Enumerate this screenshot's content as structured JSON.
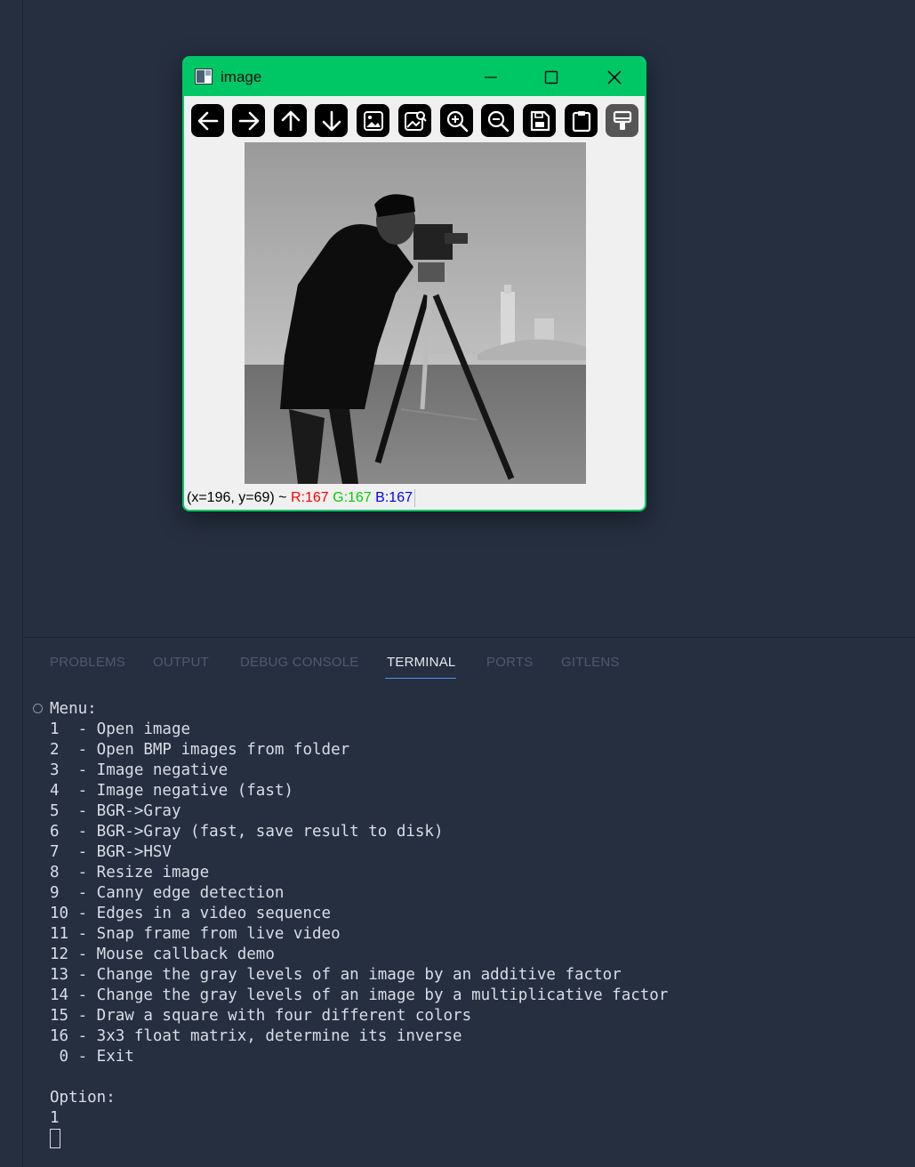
{
  "window": {
    "title": "image",
    "minimize_glyph": "—",
    "toolbar": [
      {
        "name": "pan-left",
        "icon": "arrow-left-icon"
      },
      {
        "name": "pan-right",
        "icon": "arrow-right-icon"
      },
      {
        "name": "pan-up",
        "icon": "arrow-up-icon"
      },
      {
        "name": "pan-down",
        "icon": "arrow-down-icon"
      },
      {
        "name": "zoom-original",
        "icon": "image-icon"
      },
      {
        "name": "zoom-fit",
        "icon": "image-fit-icon"
      },
      {
        "name": "zoom-in",
        "icon": "zoom-in-icon"
      },
      {
        "name": "zoom-out",
        "icon": "zoom-out-icon"
      },
      {
        "name": "save",
        "icon": "save-icon"
      },
      {
        "name": "copy",
        "icon": "clipboard-icon"
      },
      {
        "name": "properties",
        "icon": "paint-brush-icon"
      }
    ],
    "status": {
      "coords": "(x=196, y=69) ~",
      "r": "R:167",
      "g": "G:167",
      "b": "B:167"
    }
  },
  "panel": {
    "tabs": [
      "PROBLEMS",
      "OUTPUT",
      "DEBUG CONSOLE",
      "TERMINAL",
      "PORTS",
      "GITLENS"
    ],
    "active_tab": "TERMINAL"
  },
  "terminal": {
    "lines": [
      "Menu:",
      "1  - Open image",
      "2  - Open BMP images from folder",
      "3  - Image negative",
      "4  - Image negative (fast)",
      "5  - BGR->Gray",
      "6  - BGR->Gray (fast, save result to disk)",
      "7  - BGR->HSV",
      "8  - Resize image",
      "9  - Canny edge detection",
      "10 - Edges in a video sequence",
      "11 - Snap frame from live video",
      "12 - Mouse callback demo",
      "13 - Change the gray levels of an image by an additive factor",
      "14 - Change the gray levels of an image by a multiplicative factor",
      "15 - Draw a square with four different colors",
      "16 - 3x3 float matrix, determine its inverse",
      " 0 - Exit",
      "",
      "Option:",
      "1"
    ]
  },
  "colors": {
    "background": "#262f40",
    "window_accent": "#00c766",
    "tab_active_underline": "#4d8ef0"
  }
}
